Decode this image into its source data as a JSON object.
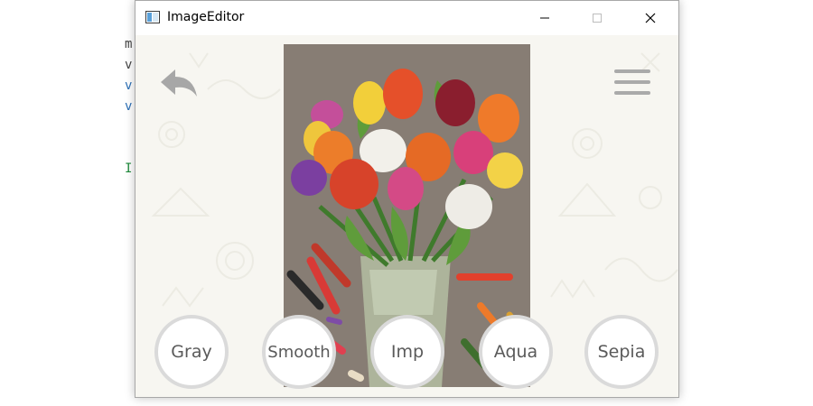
{
  "window": {
    "title": "ImageEditor",
    "app_icon": "window-app-icon"
  },
  "window_controls": {
    "minimize_icon": "minimize-icon",
    "maximize_icon": "maximize-icon",
    "close_icon": "close-icon"
  },
  "background_code": [
    "m",
    "v",
    "v",
    "v",
    "I"
  ],
  "toolbar": {
    "back_icon": "back-arrow-icon",
    "menu_icon": "hamburger-menu-icon"
  },
  "filters": [
    "Gray",
    "Smooth",
    "Imp",
    "Aqua",
    "Sepia"
  ],
  "image": {
    "subject": "painting of tulips in a glass vase with pastel sticks"
  },
  "colors": {
    "filter_text": "#5a5a5a",
    "filter_border": "#dadada",
    "icon_gray": "#aaaaaa"
  }
}
